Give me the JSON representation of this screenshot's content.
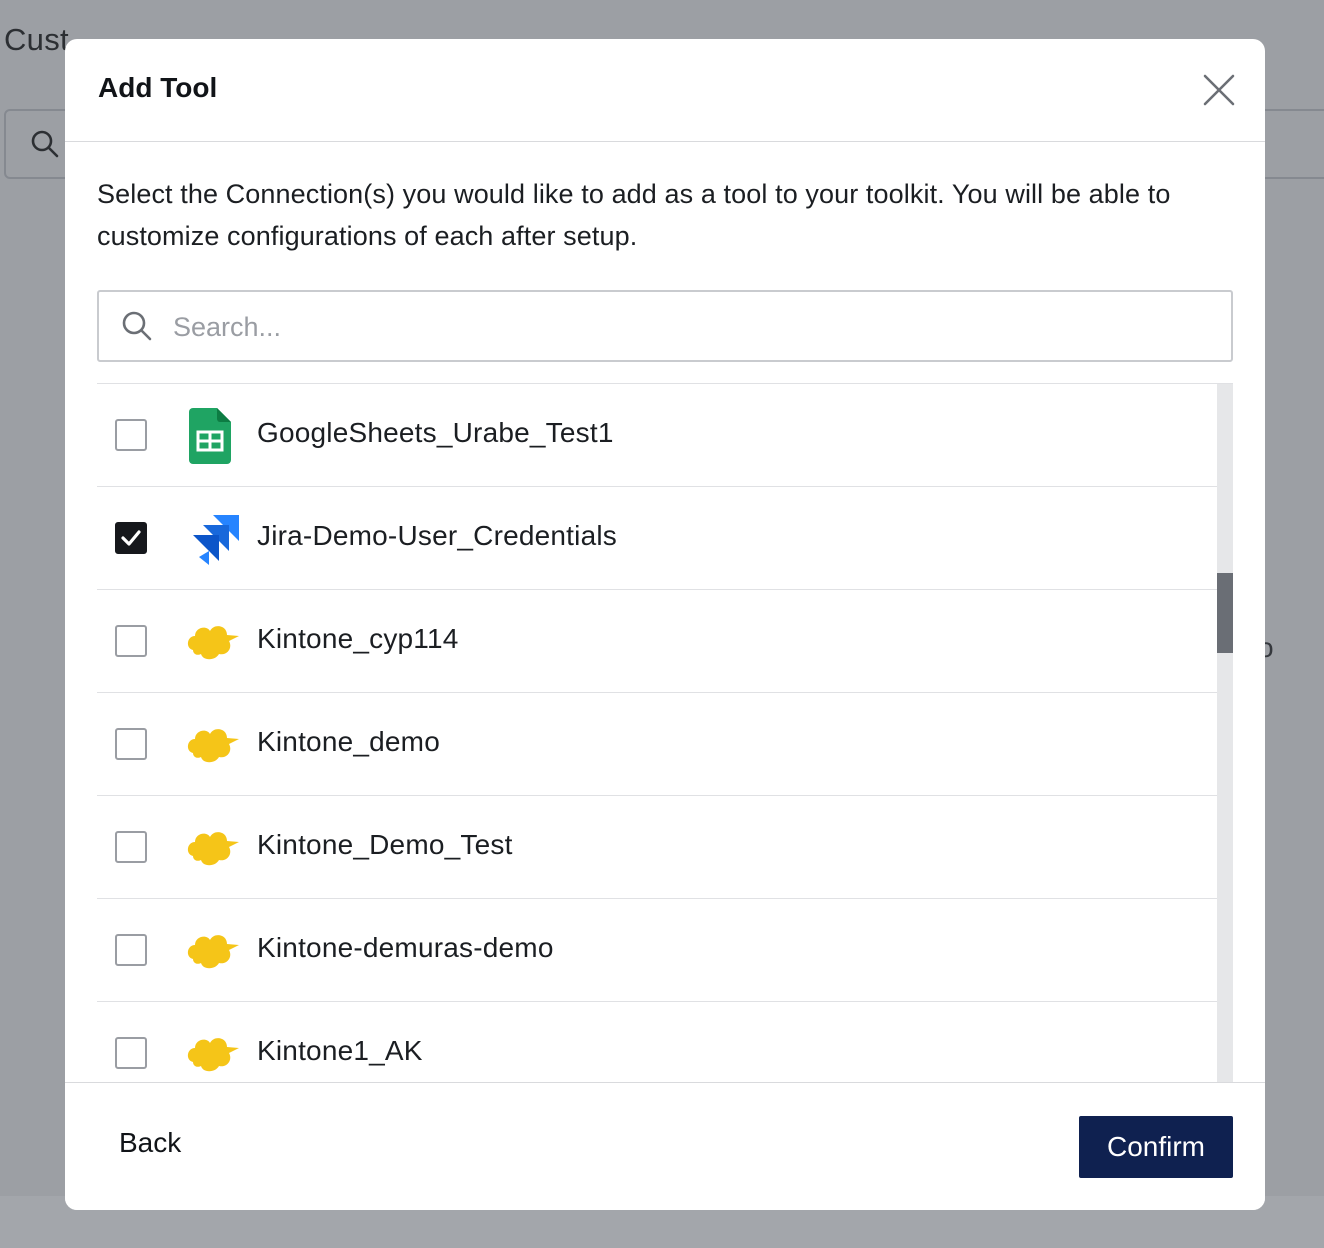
{
  "background": {
    "title_fragment": "Cust",
    "hint_fragment": "ll to"
  },
  "modal": {
    "title": "Add Tool",
    "close_icon": "close-icon",
    "description": "Select the Connection(s) you would like to add as a tool to your toolkit. You will be able to customize configurations of each after setup.",
    "search": {
      "placeholder": "Search...",
      "value": ""
    },
    "connections": [
      {
        "label": "GoogleSheets_Urabe_Test1",
        "icon": "google-sheets-icon",
        "checked": false
      },
      {
        "label": "Jira-Demo-User_Credentials",
        "icon": "jira-icon",
        "checked": true
      },
      {
        "label": "Kintone_cyp114",
        "icon": "kintone-cloud-icon",
        "checked": false
      },
      {
        "label": "Kintone_demo",
        "icon": "kintone-cloud-icon",
        "checked": false
      },
      {
        "label": "Kintone_Demo_Test",
        "icon": "kintone-cloud-icon",
        "checked": false
      },
      {
        "label": "Kintone-demuras-demo",
        "icon": "kintone-cloud-icon",
        "checked": false
      },
      {
        "label": "Kintone1_AK",
        "icon": "kintone-cloud-icon",
        "checked": false
      }
    ],
    "footer": {
      "back_label": "Back",
      "confirm_label": "Confirm"
    }
  },
  "colors": {
    "confirm_bg": "#0f2150",
    "sheets_green": "#1fa463",
    "jira_blue": "#2684ff",
    "kintone_yellow": "#f5c518",
    "overlay": "#9c9fa4"
  }
}
